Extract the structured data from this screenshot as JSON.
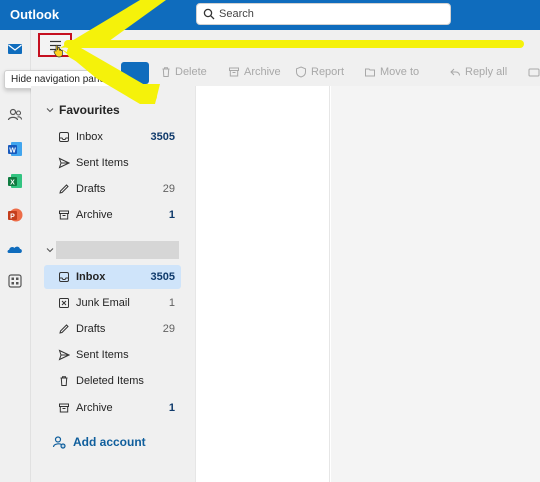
{
  "app": {
    "title": "Outlook"
  },
  "search": {
    "placeholder": "Search"
  },
  "toolbar": {
    "delete_label": "Delete",
    "archive_label": "Archive",
    "report_label": "Report",
    "move_label": "Move to",
    "reply_all_label": "Reply all"
  },
  "tooltip": {
    "text": "Hide navigation pane"
  },
  "favourites": {
    "heading": "Favourites",
    "items": [
      {
        "label": "Inbox",
        "count": "3505"
      },
      {
        "label": "Sent Items",
        "count": ""
      },
      {
        "label": "Drafts",
        "count": "29"
      },
      {
        "label": "Archive",
        "count": "1"
      }
    ]
  },
  "mailbox": {
    "items": [
      {
        "label": "Inbox",
        "count": "3505"
      },
      {
        "label": "Junk Email",
        "count": "1"
      },
      {
        "label": "Drafts",
        "count": "29"
      },
      {
        "label": "Sent Items",
        "count": ""
      },
      {
        "label": "Deleted Items",
        "count": ""
      },
      {
        "label": "Archive",
        "count": "1"
      }
    ]
  },
  "add_account": {
    "label": "Add account"
  },
  "colors": {
    "brand": "#0f6cbd",
    "selected": "#cfe4fa",
    "highlight_box": "#c50f1f",
    "arrow": "#f5f20a"
  },
  "icons": [
    "search-icon",
    "mail-icon",
    "people-icon",
    "word-icon",
    "excel-icon",
    "powerpoint-icon",
    "onedrive-icon",
    "apps-icon",
    "hamburger-icon",
    "inbox-icon",
    "send-icon",
    "drafts-icon",
    "archive-icon",
    "junk-icon",
    "delete-icon",
    "add-account-icon"
  ]
}
